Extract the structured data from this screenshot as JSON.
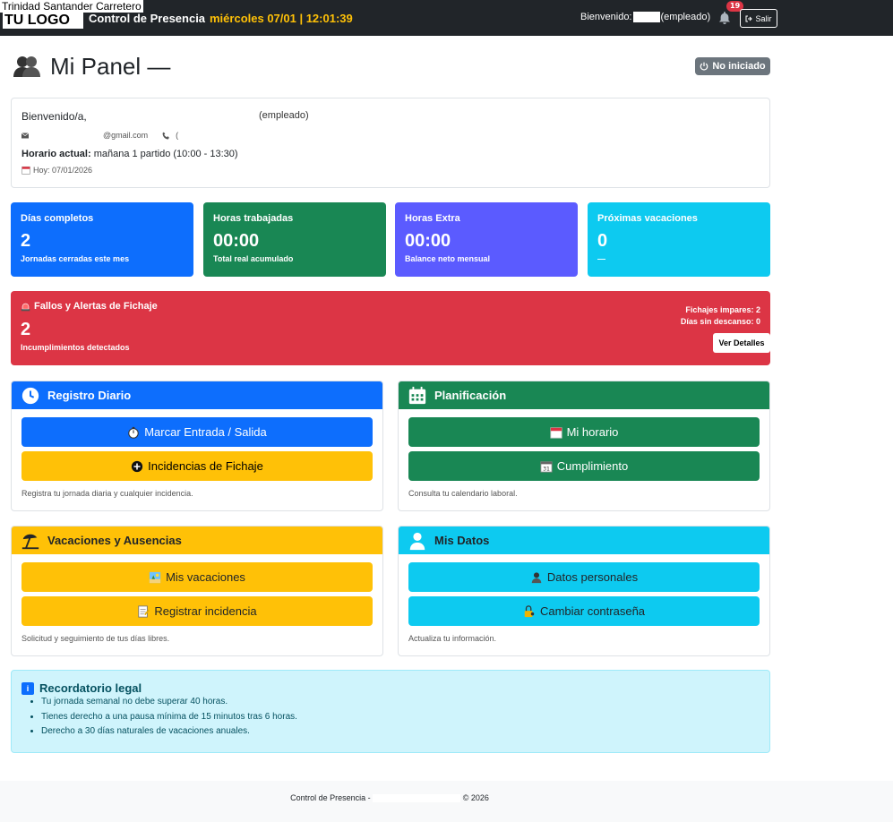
{
  "navbar": {
    "company_name": "Trinidad Santander Carretero",
    "logo": "TU LOGO",
    "brand": "Control de Presencia",
    "datetime": "miércoles 07/01 | 12:01:39",
    "welcome_prefix": "Bienvenido:",
    "welcome_suffix": "(empleado)",
    "notification_count": "19",
    "logout_label": "Salir"
  },
  "header": {
    "title": "Mi Panel —",
    "status": "No iniciado"
  },
  "profile": {
    "greeting": "Bienvenido/a,",
    "role": "(empleado)",
    "email": "@gmail.com",
    "phone": "(",
    "schedule_label": "Horario actual:",
    "schedule_value": "mañana 1 partido (10:00 - 13:30)",
    "today": "Hoy: 07/01/2026"
  },
  "stats": [
    {
      "title": "Días completos",
      "value": "2",
      "subtitle": "Jornadas cerradas este mes",
      "color": "#0d6efd"
    },
    {
      "title": "Horas trabajadas",
      "value": "00:00",
      "subtitle": "Total real acumulado",
      "color": "#198754"
    },
    {
      "title": "Horas Extra",
      "value": "00:00",
      "subtitle": "Balance neto mensual",
      "color": "#5b5bff"
    },
    {
      "title": "Próximas vacaciones",
      "value": "0",
      "subtitle": "—",
      "color": "#0dcaf0"
    }
  ],
  "alerts": {
    "title": "Fallos y Alertas de Fichaje",
    "value": "2",
    "subtitle": "Incumplimientos detectados",
    "odd_label": "Fichajes impares:",
    "odd_value": "2",
    "rest_label": "Días sin descanso:",
    "rest_value": "0",
    "button": "Ver Detalles"
  },
  "panels": {
    "daily": {
      "title": "Registro Diario",
      "btn1": "Marcar Entrada / Salida",
      "btn2": "Incidencias de Fichaje",
      "footer": "Registra tu jornada diaria y cualquier incidencia."
    },
    "planning": {
      "title": "Planificación",
      "btn1": "Mi horario",
      "btn2": "Cumplimiento",
      "footer": "Consulta tu calendario laboral."
    },
    "vacations": {
      "title": "Vacaciones y Ausencias",
      "btn1": "Mis vacaciones",
      "btn2": "Registrar incidencia",
      "footer": "Solicitud y seguimiento de tus días libres."
    },
    "mydata": {
      "title": "Mis Datos",
      "btn1": "Datos personales",
      "btn2": "Cambiar contraseña",
      "footer": "Actualiza tu información."
    }
  },
  "reminder": {
    "title": "Recordatorio legal",
    "items": [
      "Tu jornada semanal no debe superar 40 horas.",
      "Tienes derecho a una pausa mínima de 15 minutos tras 6 horas.",
      "Derecho a 30 días naturales de vacaciones anuales."
    ]
  },
  "footer": {
    "prefix": "Control de Presencia -",
    "suffix": "© 2026"
  },
  "colors": {
    "primary": "#0d6efd",
    "success": "#198754",
    "warning": "#ffc107",
    "info": "#0dcaf0",
    "danger": "#dc3545",
    "dark": "#212529"
  }
}
